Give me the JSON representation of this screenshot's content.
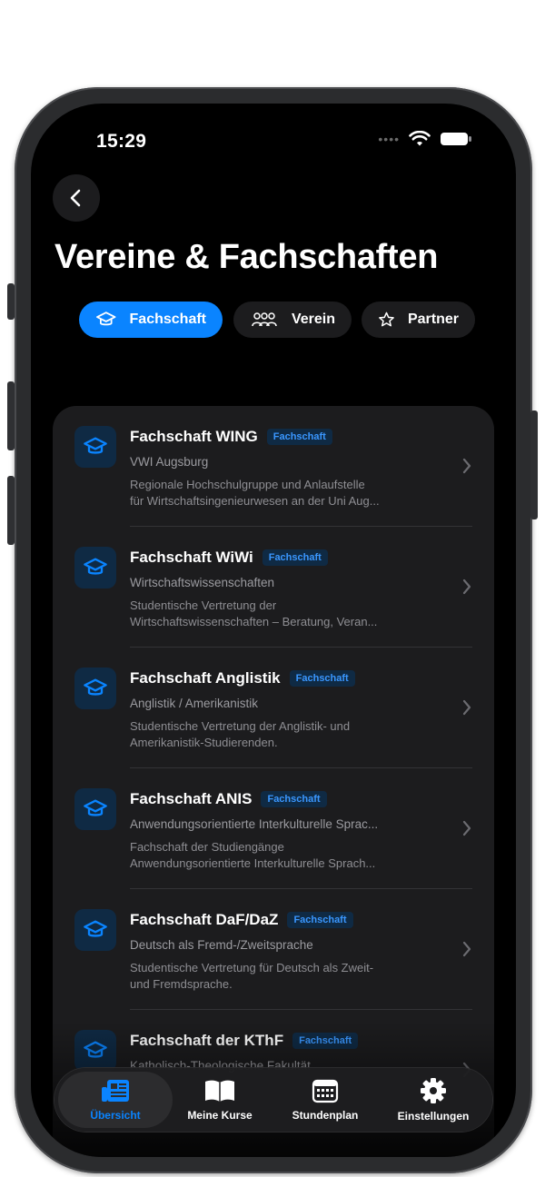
{
  "status": {
    "time": "15:29"
  },
  "page": {
    "title": "Vereine & Fachschaften"
  },
  "segments": [
    {
      "label": "Fachschaft",
      "icon": "graduation-cap-icon",
      "selected": true
    },
    {
      "label": "Verein",
      "icon": "people-group-icon",
      "selected": false
    },
    {
      "label": "Partner",
      "icon": "star-icon",
      "selected": false
    }
  ],
  "items": [
    {
      "name": "Fachschaft WING",
      "badge": "Fachschaft",
      "subtitle": "VWI Augsburg",
      "desc1": "Regionale Hochschulgruppe und Anlaufstelle",
      "desc2": "für Wirtschaftsingenieurwesen an der Uni Aug..."
    },
    {
      "name": "Fachschaft WiWi",
      "badge": "Fachschaft",
      "subtitle": "Wirtschaftswissenschaften",
      "desc1": "Studentische Vertretung der",
      "desc2": "Wirtschaftswissenschaften – Beratung, Veran..."
    },
    {
      "name": "Fachschaft Anglistik",
      "badge": "Fachschaft",
      "subtitle": "Anglistik / Amerikanistik",
      "desc1": "Studentische Vertretung der Anglistik- und",
      "desc2": "Amerikanistik-Studierenden."
    },
    {
      "name": "Fachschaft ANIS",
      "badge": "Fachschaft",
      "subtitle": "Anwendungsorientierte Interkulturelle Sprac...",
      "desc1": "Fachschaft der Studiengänge",
      "desc2": "Anwendungsorientierte Interkulturelle Sprach..."
    },
    {
      "name": "Fachschaft DaF/DaZ",
      "badge": "Fachschaft",
      "subtitle": "Deutsch als Fremd-/Zweitsprache",
      "desc1": "Studentische Vertretung für Deutsch als Zweit-",
      "desc2": "und Fremdsprache."
    },
    {
      "name": "Fachschaft der KThF",
      "badge": "Fachschaft",
      "subtitle": "Katholisch-Theologische Fakultät",
      "desc1": "",
      "desc2": ""
    }
  ],
  "tabbar": [
    {
      "label": "Übersicht",
      "icon": "newspaper-icon",
      "selected": true
    },
    {
      "label": "Meine Kurse",
      "icon": "book-icon",
      "selected": false
    },
    {
      "label": "Stundenplan",
      "icon": "calendar-icon",
      "selected": false
    },
    {
      "label": "Einstellungen",
      "icon": "gear-icon",
      "selected": false
    }
  ],
  "colors": {
    "accent": "#0a84ff",
    "background": "#000000",
    "card": "#1c1c1e",
    "badge_text": "#3a97ff"
  }
}
